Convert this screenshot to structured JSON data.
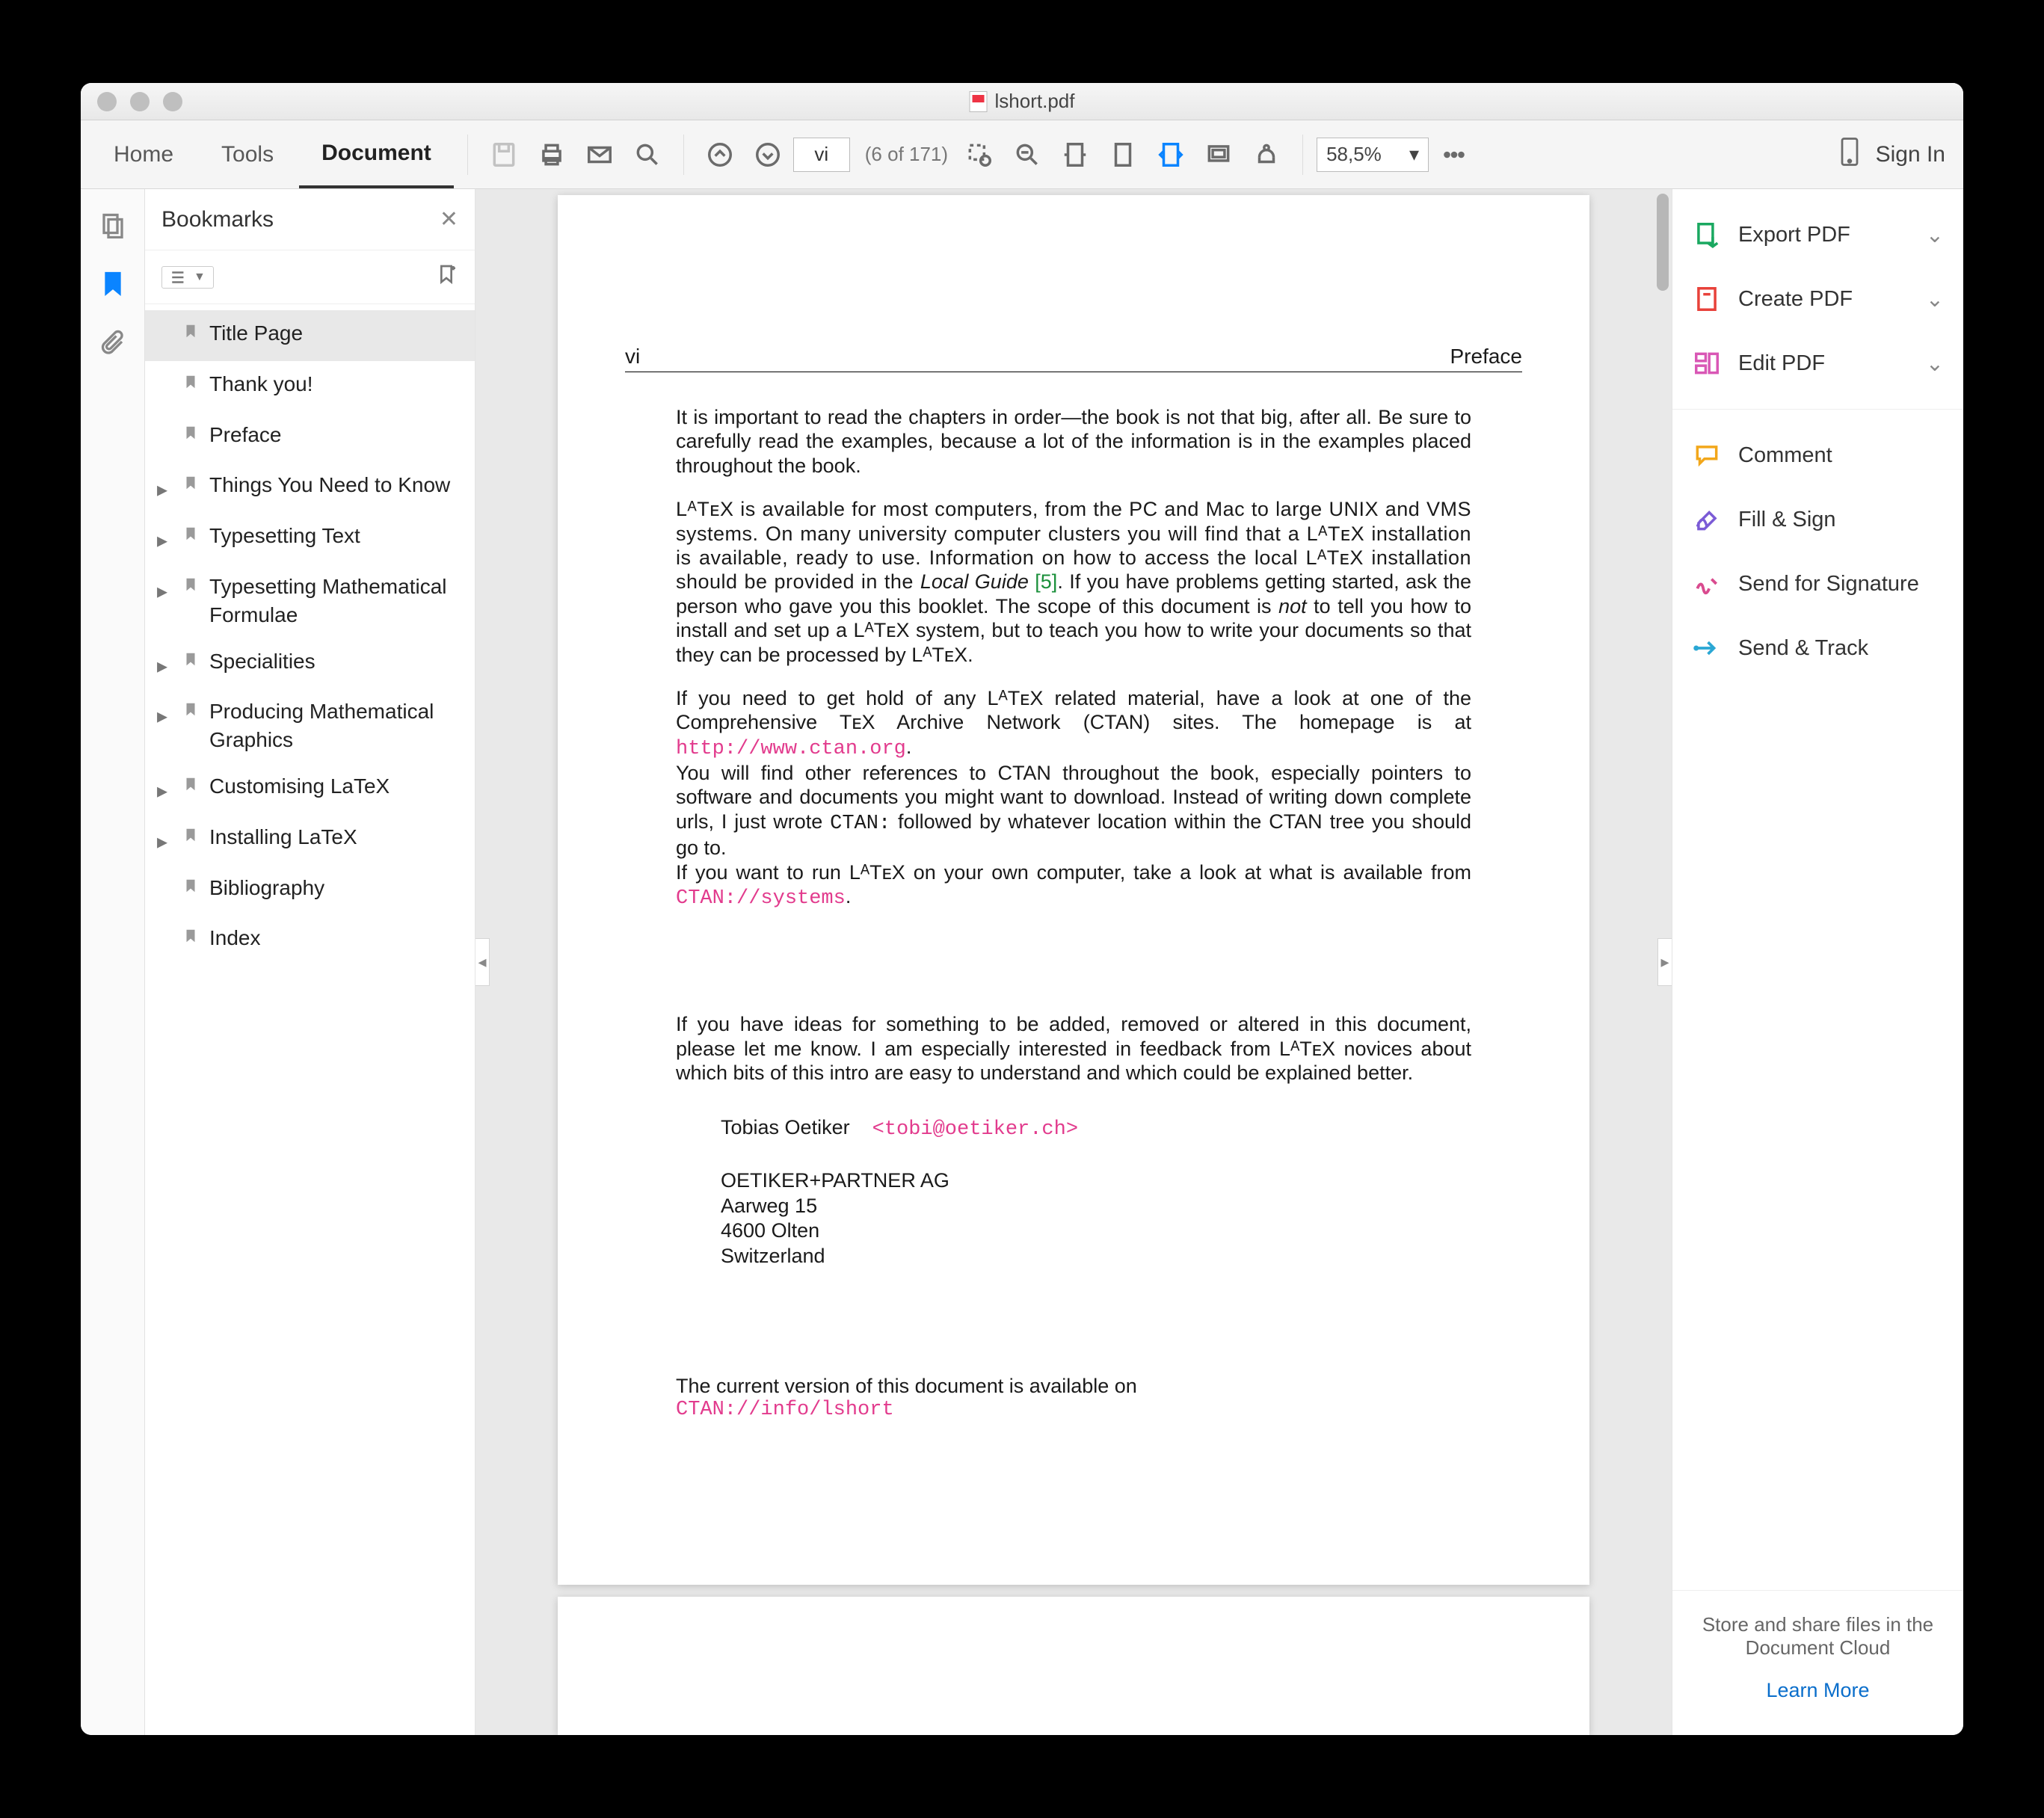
{
  "title": "lshort.pdf",
  "tabs": {
    "home": "Home",
    "tools": "Tools",
    "document": "Document"
  },
  "page_input": "vi",
  "page_of": "(6 of 171)",
  "zoom": "58,5%",
  "signin": "Sign In",
  "bookmarks_title": "Bookmarks",
  "bookmarks": [
    {
      "label": "Title Page",
      "expandable": false,
      "selected": true
    },
    {
      "label": "Thank you!",
      "expandable": false,
      "selected": false
    },
    {
      "label": "Preface",
      "expandable": false,
      "selected": false
    },
    {
      "label": "Things You Need to Know",
      "expandable": true,
      "selected": false
    },
    {
      "label": "Typesetting Text",
      "expandable": true,
      "selected": false
    },
    {
      "label": "Typesetting Mathematical Formulae",
      "expandable": true,
      "selected": false
    },
    {
      "label": "Specialities",
      "expandable": true,
      "selected": false
    },
    {
      "label": "Producing Mathematical Graphics",
      "expandable": true,
      "selected": false
    },
    {
      "label": "Customising LaTeX",
      "expandable": true,
      "selected": false
    },
    {
      "label": "Installing LaTeX",
      "expandable": true,
      "selected": false
    },
    {
      "label": "Bibliography",
      "expandable": false,
      "selected": false
    },
    {
      "label": "Index",
      "expandable": false,
      "selected": false
    }
  ],
  "doc": {
    "page_num": "vi",
    "section": "Preface",
    "p1": "It is important to read the chapters in order—the book is not that big, after all. Be sure to carefully read the examples, because a lot of the information is in the examples placed throughout the book.",
    "p2a": "LᴬTᴇX is available for most computers, from the PC and Mac to large UNIX and VMS systems. On many university computer clusters you will find that a LᴬTᴇX installation is available, ready to use. Information on how to access the local LᴬTᴇX installation should be provided in the ",
    "p2_guide": "Local Guide",
    "p2_ref": " [5]",
    "p2b": ". If you have problems getting started, ask the person who gave you this booklet. The scope of this document is ",
    "p2_not": "not",
    "p2c": " to tell you how to install and set up a LᴬTᴇX system, but to teach you how to write your documents so that they can be processed by LᴬTᴇX.",
    "p3a": "If you need to get hold of any LᴬTᴇX related material, have a look at one of the Comprehensive TᴇX Archive Network (CTAN) sites. The homepage is at ",
    "p3_url": "http://www.ctan.org",
    "p3b": ".",
    "p4a": "You will find other references to CTAN throughout the book, especially pointers to software and documents you might want to download. Instead of writing down complete urls, I just wrote ",
    "p4_ctan": "CTAN:",
    "p4b": " followed by whatever location within the CTAN tree you should go to.",
    "p5a": "If you want to run LᴬTᴇX on your own computer, take a look at what is available from ",
    "p5_url": "CTAN://systems",
    "p5b": ".",
    "p6": "If you have ideas for something to be added, removed or altered in this document, please let me know. I am especially interested in feedback from LᴬTᴇX novices about which bits of this intro are easy to understand and which could be explained better.",
    "author": "Tobias Oetiker",
    "email": "<tobi@oetiker.ch>",
    "org": "OETIKER+PARTNER AG",
    "addr1": "Aarweg 15",
    "addr2": "4600 Olten",
    "addr3": "Switzerland",
    "avail": "The current version of this document is available on",
    "avail_url": "CTAN://info/lshort"
  },
  "rtools": {
    "export": "Export PDF",
    "create": "Create PDF",
    "edit": "Edit PDF",
    "comment": "Comment",
    "fill": "Fill & Sign",
    "sendfor": "Send for Signature",
    "sendtrack": "Send & Track"
  },
  "cloud_text": "Store and share files in the Document Cloud",
  "cloud_link": "Learn More"
}
